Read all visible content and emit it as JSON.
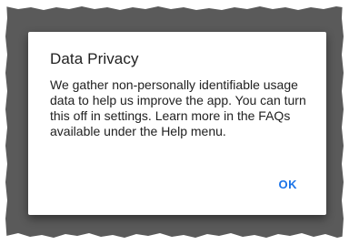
{
  "dialog": {
    "title": "Data Privacy",
    "message": "We gather non-personally identifiable usage data to help us improve the app. You can turn this off in settings. Learn more in the FAQs available under the Help menu.",
    "ok_label": "OK"
  },
  "colors": {
    "scrim": "#5a5a5a",
    "accent": "#1a73e8",
    "text": "#212121",
    "surface": "#ffffff"
  }
}
